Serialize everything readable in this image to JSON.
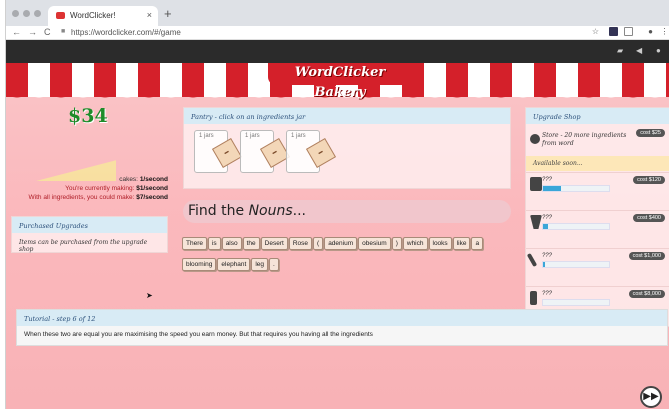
{
  "browser": {
    "tab_title": "WordClicker!",
    "new_tab": "+",
    "close_tab": "×",
    "url": "https://wordclicker.com/#/game",
    "back": "←",
    "forward": "→",
    "reload": "C"
  },
  "game": {
    "title": "WordClicker Bakery",
    "money": "$34",
    "stats": {
      "cakes_label": "cakes:",
      "cakes_rate": "1/second",
      "making_label": "You're currently making:",
      "making_rate": "$1/second",
      "could_label": "With all ingredients, you could make:",
      "could_rate": "$7/second"
    },
    "purchased_upgrades": {
      "title": "Purchased Upgrades",
      "body": "Items can be purchased from the upgrade shop"
    },
    "pantry": {
      "title": "Pantry - click on an ingredients jar",
      "jars": [
        "1 jars",
        "1 jars",
        "1 jars"
      ]
    },
    "find": {
      "prefix": "Find the ",
      "target": "Nouns",
      "suffix": "..."
    },
    "words": [
      "There",
      "is",
      "also",
      "the",
      "Desert",
      "Rose",
      "(",
      "adenium",
      "obesium",
      ")",
      "which",
      "looks",
      "like",
      "a",
      "blooming",
      "elephant",
      "leg",
      "."
    ],
    "upgrade_shop": {
      "title": "Upgrade Shop",
      "store_text": "Store - 20 more ingredients from word",
      "store_cost": "cost $25",
      "available_label": "Available soon...",
      "items": [
        {
          "name": "???",
          "cost": "cost $120",
          "progress": 0.28
        },
        {
          "name": "???",
          "cost": "cost $400",
          "progress": 0.08
        },
        {
          "name": "???",
          "cost": "cost $1,000",
          "progress": 0.03
        },
        {
          "name": "???",
          "cost": "cost $8,000",
          "progress": 0.0
        }
      ]
    },
    "tutorial": {
      "title": "Tutorial - step 6 of 12",
      "text": "When these two are equal you are maximising the speed you earn money. But that requires you having all the ingredients",
      "next": "▶▶"
    }
  }
}
